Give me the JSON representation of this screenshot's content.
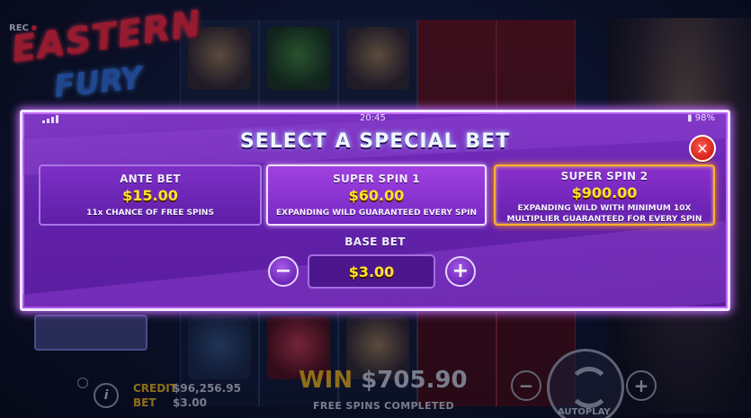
{
  "game": {
    "logo_line1": "EASTERN",
    "logo_line2": "FURY",
    "rec_label": "REC"
  },
  "status_bar": {
    "time": "20:45",
    "battery": "98%"
  },
  "modal": {
    "title": "SELECT A SPECIAL BET",
    "close_icon": "close-icon",
    "options": [
      {
        "name": "ANTE BET",
        "price": "$15.00",
        "description": "11x CHANCE OF FREE SPINS",
        "selected": false
      },
      {
        "name": "SUPER SPIN 1",
        "price": "$60.00",
        "description": "EXPANDING WILD GUARANTEED EVERY SPIN",
        "selected": false
      },
      {
        "name": "SUPER SPIN 2",
        "price": "$900.00",
        "description_line1": "EXPANDING WILD WITH MINIMUM 10X",
        "description_line2": "MULTIPLIER GUARANTEED FOR EVERY SPIN",
        "selected": true
      }
    ],
    "base_bet": {
      "label": "BASE BET",
      "value": "$3.00",
      "decrease": "−",
      "increase": "+"
    }
  },
  "footer": {
    "credit_label": "CREDIT",
    "credit_value": "$96,256.95",
    "bet_label": "BET",
    "bet_value": "$3.00",
    "win_label": "WIN",
    "win_value": "$705.90",
    "status_text": "FREE SPINS COMPLETED",
    "autoplay_label": "AUTOPLAY",
    "minus": "−",
    "plus": "+",
    "info": "i"
  },
  "colors": {
    "modal_purple": "#6422ad",
    "price_yellow": "#ffe22a",
    "selected_border": "#ffb12a",
    "close_red": "#d3231e"
  }
}
